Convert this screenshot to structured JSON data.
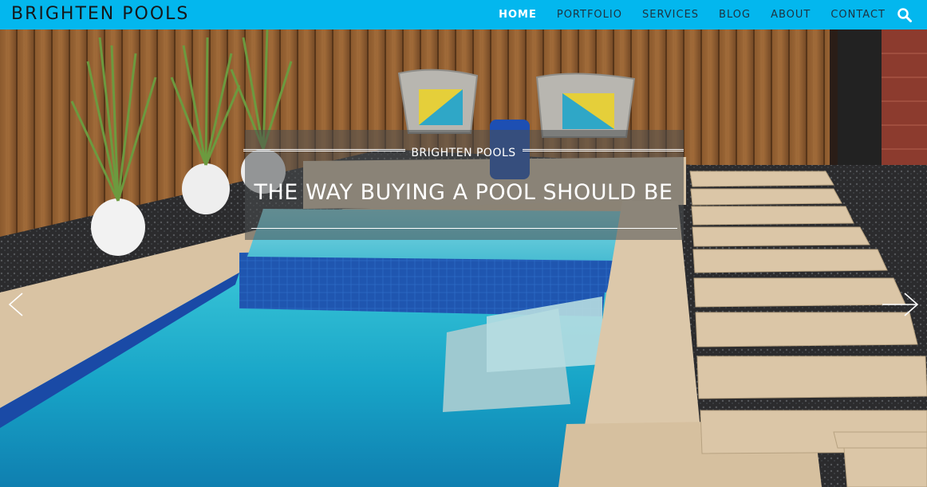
{
  "site": {
    "logo": "BRIGHTEN POOLS"
  },
  "nav": {
    "items": [
      {
        "label": "HOME",
        "active": true
      },
      {
        "label": "PORTFOLIO"
      },
      {
        "label": "SERVICES"
      },
      {
        "label": "BLOG"
      },
      {
        "label": "ABOUT"
      },
      {
        "label": "CONTACT"
      }
    ],
    "search_icon": "search-icon"
  },
  "hero": {
    "kicker": "BRIGHTEN POOLS",
    "headline": "THE WAY BUYING A POOL SHOULD BE",
    "prev_icon": "chevron-left-icon",
    "next_icon": "chevron-right-icon"
  },
  "colors": {
    "header": "#03b7ee",
    "active_nav": "#ffffff",
    "nav_text": "#1e3340"
  }
}
